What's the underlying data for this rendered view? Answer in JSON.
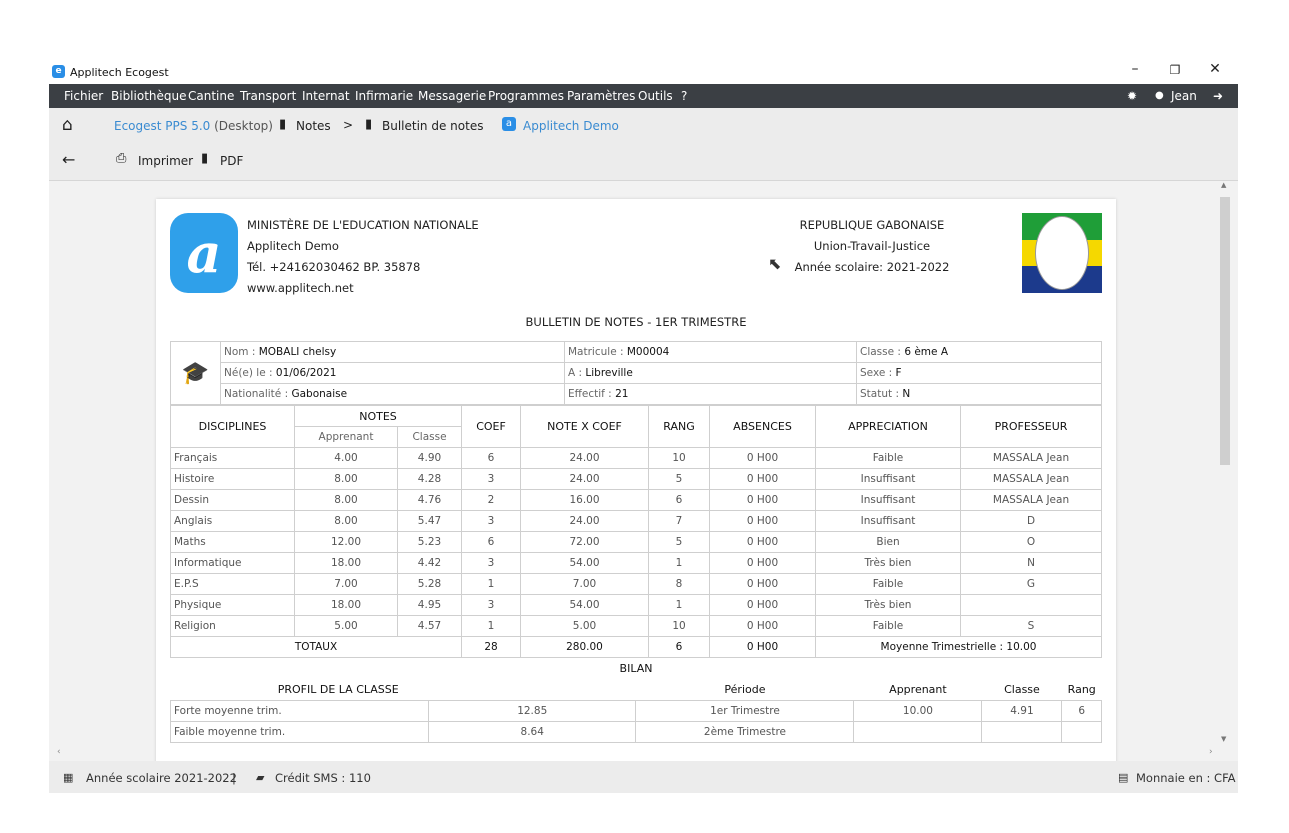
{
  "window": {
    "app_title": "Applitech Ecogest",
    "app_logo_letter": "e",
    "minimize": "–",
    "restore": "❐",
    "close": "✕"
  },
  "menu": {
    "items": [
      "Fichier",
      "Bibliothèque",
      "Cantine",
      "Transport",
      "Internat",
      "Infirmarie",
      "Messagerie",
      "Programmes",
      "Paramètres",
      "Outils",
      "?"
    ],
    "user": "Jean"
  },
  "toolbar": {
    "app_name": "Ecogest PPS 5.0",
    "app_mode": "(Desktop)",
    "crumb_notes": "Notes",
    "crumb_sep": ">",
    "crumb_bulletin": "Bulletin de notes",
    "company": "Applitech Demo",
    "print_label": "Imprimer",
    "pdf_label": "PDF"
  },
  "report": {
    "ministry": "MINISTÈRE DE L'EDUCATION NATIONALE",
    "school": "Applitech Demo",
    "phone": "Tél. +24162030462   BP. 35878",
    "website": "www.applitech.net",
    "country": "REPUBLIQUE GABONAISE",
    "motto": "Union-Travail-Justice",
    "school_year": "Année scolaire: 2021-2022",
    "title": "BULLETIN DE NOTES - 1ER TRIMESTRE",
    "logo_letter": "a",
    "student": {
      "name_label": "Nom :",
      "name": "MOBALI chelsy",
      "matricule_label": "Matricule :",
      "matricule": "M00004",
      "classe_label": "Classe :",
      "classe": "6 ème A",
      "birth_label": "Né(e) le :",
      "birth": "01/06/2021",
      "place_label": "A :",
      "place": "Libreville",
      "sexe_label": "Sexe :",
      "sexe": "F",
      "nationality_label": "Nationalité :",
      "nationality": "Gabonaise",
      "effectif_label": "Effectif :",
      "effectif": "21",
      "statut_label": "Statut :",
      "statut": "N"
    },
    "columns": {
      "disciplines": "DISCIPLINES",
      "notes": "NOTES",
      "apprenant": "Apprenant",
      "classe": "Classe",
      "coef": "COEF",
      "note_x_coef": "NOTE X COEF",
      "rang": "RANG",
      "absences": "ABSENCES",
      "appreciation": "APPRECIATION",
      "professeur": "PROFESSEUR"
    },
    "rows": [
      {
        "discipline": "Français",
        "apprenant": "4.00",
        "classe": "4.90",
        "coef": "6",
        "note_coef": "24.00",
        "rang": "10",
        "absences": "0 H00",
        "appreciation": "Faible",
        "professeur": "MASSALA Jean"
      },
      {
        "discipline": "Histoire",
        "apprenant": "8.00",
        "classe": "4.28",
        "coef": "3",
        "note_coef": "24.00",
        "rang": "5",
        "absences": "0 H00",
        "appreciation": "Insuffisant",
        "professeur": "MASSALA Jean"
      },
      {
        "discipline": "Dessin",
        "apprenant": "8.00",
        "classe": "4.76",
        "coef": "2",
        "note_coef": "16.00",
        "rang": "6",
        "absences": "0 H00",
        "appreciation": "Insuffisant",
        "professeur": "MASSALA Jean"
      },
      {
        "discipline": "Anglais",
        "apprenant": "8.00",
        "classe": "5.47",
        "coef": "3",
        "note_coef": "24.00",
        "rang": "7",
        "absences": "0 H00",
        "appreciation": "Insuffisant",
        "professeur": "D"
      },
      {
        "discipline": "Maths",
        "apprenant": "12.00",
        "classe": "5.23",
        "coef": "6",
        "note_coef": "72.00",
        "rang": "5",
        "absences": "0 H00",
        "appreciation": "Bien",
        "professeur": "O"
      },
      {
        "discipline": "Informatique",
        "apprenant": "18.00",
        "classe": "4.42",
        "coef": "3",
        "note_coef": "54.00",
        "rang": "1",
        "absences": "0 H00",
        "appreciation": "Très bien",
        "professeur": "N"
      },
      {
        "discipline": "E.P.S",
        "apprenant": "7.00",
        "classe": "5.28",
        "coef": "1",
        "note_coef": "7.00",
        "rang": "8",
        "absences": "0 H00",
        "appreciation": "Faible",
        "professeur": "G"
      },
      {
        "discipline": "Physique",
        "apprenant": "18.00",
        "classe": "4.95",
        "coef": "3",
        "note_coef": "54.00",
        "rang": "1",
        "absences": "0 H00",
        "appreciation": "Très bien",
        "professeur": ""
      },
      {
        "discipline": "Religion",
        "apprenant": "5.00",
        "classe": "4.57",
        "coef": "1",
        "note_coef": "5.00",
        "rang": "10",
        "absences": "0 H00",
        "appreciation": "Faible",
        "professeur": "S"
      }
    ],
    "totals": {
      "label": "TOTAUX",
      "coef": "28",
      "note_coef": "280.00",
      "rang": "6",
      "absences": "0 H00",
      "moyenne": "Moyenne Trimestrielle : 10.00"
    },
    "bilan": {
      "title": "BILAN",
      "profil_header": "PROFIL DE LA CLASSE",
      "periode_header": "Période",
      "apprenant_header": "Apprenant",
      "classe_header": "Classe",
      "rang_header": "Rang",
      "rows": [
        {
          "label": "Forte moyenne trim.",
          "value": "12.85",
          "periode": "1er Trimestre",
          "apprenant": "10.00",
          "classe": "4.91",
          "rang": "6"
        },
        {
          "label": "Faible moyenne trim.",
          "value": "8.64",
          "periode": "2ème Trimestre",
          "apprenant": "",
          "classe": "",
          "rang": ""
        }
      ]
    }
  },
  "status": {
    "school_year": "Année scolaire 2021-2022",
    "separator": "|",
    "sms": "Crédit SMS : 110",
    "currency": "Monnaie en : CFA"
  }
}
